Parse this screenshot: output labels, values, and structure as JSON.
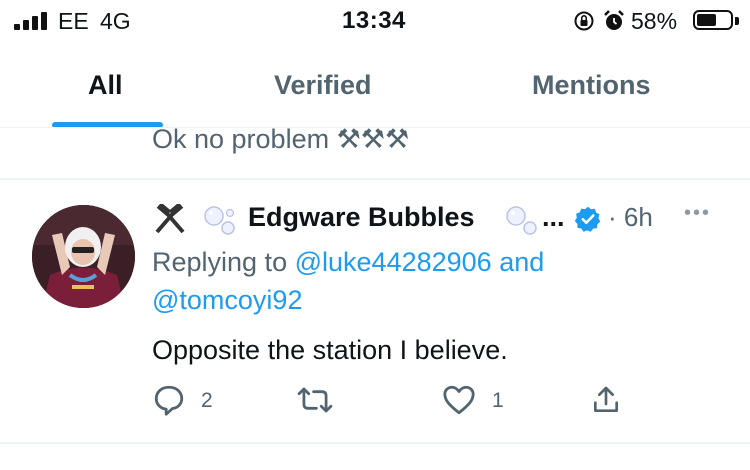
{
  "status_bar": {
    "carrier": "EE",
    "network": "4G",
    "time": "13:34",
    "battery_percent": "58%",
    "battery_level": 0.58
  },
  "tabs": [
    {
      "label": "All",
      "active": true
    },
    {
      "label": "Verified",
      "active": false
    },
    {
      "label": "Mentions",
      "active": false
    }
  ],
  "previous_tweet": {
    "text": "Ok no problem ⚒⚒⚒"
  },
  "tweet": {
    "name": "Edgware Bubbles",
    "name_ellipsis": "...",
    "time": "· 6h",
    "more": "•••",
    "replying_prefix": "Replying to",
    "mention1": "@luke44282906",
    "and": "and",
    "mention2": "@tomcoyi92",
    "text": "Opposite the station I believe.",
    "replies": "2",
    "likes": "1"
  },
  "colors": {
    "accent": "#1d9bf0",
    "secondary_text": "#536471",
    "primary_text": "#0f1419",
    "verified": "#1d9bf0"
  }
}
